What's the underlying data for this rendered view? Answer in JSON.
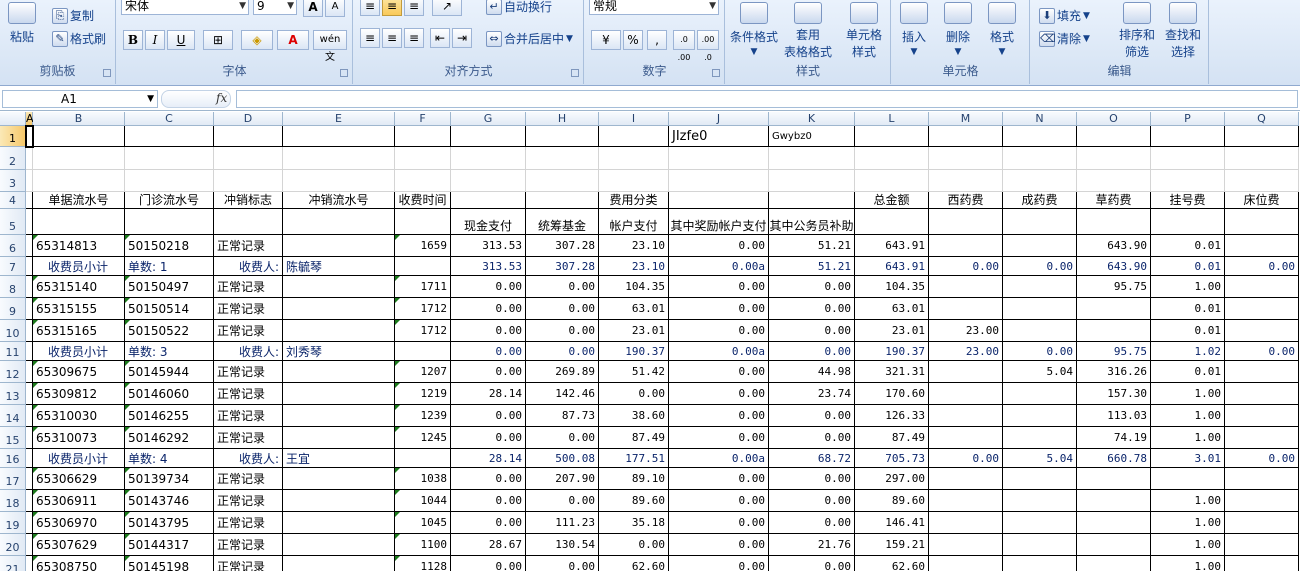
{
  "ribbon": {
    "clipboard": {
      "paste": "粘贴",
      "copy": "复制",
      "format_painter": "格式刷",
      "label": "剪贴板"
    },
    "font": {
      "name": "宋体",
      "size": "9",
      "label": "字体",
      "bold": "B",
      "italic": "I",
      "underline": "U",
      "grow": "A",
      "shrink": "A",
      "phonetic": "wén 文",
      "font_color": "A"
    },
    "alignment": {
      "wrap": "自动换行",
      "merge": "合并后居中",
      "label": "对齐方式"
    },
    "number": {
      "format": "常规",
      "percent": "%",
      "comma": ",",
      "inc_dec": ".0 .00",
      "dec_dec": ".00 .0",
      "label": "数字"
    },
    "styles": {
      "conditional": "条件格式",
      "table_fmt_1": "套用",
      "table_fmt_2": "表格格式",
      "cell_style_1": "单元格",
      "cell_style_2": "样式",
      "label": "样式"
    },
    "cells": {
      "insert": "插入",
      "delete": "删除",
      "format": "格式",
      "label": "单元格"
    },
    "editing": {
      "fill": "填充",
      "clear": "清除",
      "sort_1": "排序和",
      "sort_2": "筛选",
      "find_1": "查找和",
      "find_2": "选择",
      "label": "编辑"
    }
  },
  "formula_bar": {
    "name_box": "A1",
    "fx": "fx",
    "content": ""
  },
  "columns": [
    "A",
    "B",
    "C",
    "D",
    "E",
    "F",
    "G",
    "H",
    "I",
    "J",
    "K",
    "L",
    "M",
    "N",
    "O",
    "P",
    "Q"
  ],
  "rows": [
    {
      "n": "1",
      "cells": {
        "J": "JIzfe0",
        "K": "Gwybz0"
      }
    },
    {
      "n": "2",
      "cells": {}
    },
    {
      "n": "3",
      "cells": {}
    },
    {
      "n": "4",
      "cells": {
        "B": "单据流水号",
        "C": "门诊流水号",
        "D": "冲销标志",
        "E": "冲销流水号",
        "F": "收费时间",
        "I": "费用分类",
        "L": "总金额",
        "M": "西药费",
        "N": "成药费",
        "O": "草药费",
        "P": "挂号费",
        "Q": "床位费"
      }
    },
    {
      "n": "5",
      "cells": {
        "G": "现金支付",
        "H": "统筹基金",
        "I": "帐户支付",
        "J": "其中奖励帐户支付",
        "K": "其中公务员补助"
      }
    },
    {
      "n": "6",
      "cells": {
        "B": "65314813",
        "C": "50150218",
        "D": "正常记录",
        "F": "1659",
        "G": "313.53",
        "H": "307.28",
        "I": "23.10",
        "J": "0.00",
        "K": "51.21",
        "L": "643.91",
        "O": "643.90",
        "P": "0.01"
      }
    },
    {
      "n": "7",
      "sub": true,
      "cells": {
        "B": "收费员小计",
        "C": "单数: 1",
        "D": "收费人:",
        "E": "陈毓琴",
        "G": "313.53",
        "H": "307.28",
        "I": "23.10",
        "J": "0.00a",
        "K": "51.21",
        "L": "643.91",
        "M": "0.00",
        "N": "0.00",
        "O": "643.90",
        "P": "0.01",
        "Q": "0.00"
      }
    },
    {
      "n": "8",
      "cells": {
        "B": "65315140",
        "C": "50150497",
        "D": "正常记录",
        "F": "1711",
        "G": "0.00",
        "H": "0.00",
        "I": "104.35",
        "J": "0.00",
        "K": "0.00",
        "L": "104.35",
        "O": "95.75",
        "P": "1.00"
      }
    },
    {
      "n": "9",
      "cells": {
        "B": "65315155",
        "C": "50150514",
        "D": "正常记录",
        "F": "1712",
        "G": "0.00",
        "H": "0.00",
        "I": "63.01",
        "J": "0.00",
        "K": "0.00",
        "L": "63.01",
        "P": "0.01"
      }
    },
    {
      "n": "10",
      "cells": {
        "B": "65315165",
        "C": "50150522",
        "D": "正常记录",
        "F": "1712",
        "G": "0.00",
        "H": "0.00",
        "I": "23.01",
        "J": "0.00",
        "K": "0.00",
        "L": "23.01",
        "M": "23.00",
        "P": "0.01"
      }
    },
    {
      "n": "11",
      "sub": true,
      "cells": {
        "B": "收费员小计",
        "C": "单数: 3",
        "D": "收费人:",
        "E": "刘秀琴",
        "G": "0.00",
        "H": "0.00",
        "I": "190.37",
        "J": "0.00a",
        "K": "0.00",
        "L": "190.37",
        "M": "23.00",
        "N": "0.00",
        "O": "95.75",
        "P": "1.02",
        "Q": "0.00"
      }
    },
    {
      "n": "12",
      "cells": {
        "B": "65309675",
        "C": "50145944",
        "D": "正常记录",
        "F": "1207",
        "G": "0.00",
        "H": "269.89",
        "I": "51.42",
        "J": "0.00",
        "K": "44.98",
        "L": "321.31",
        "N": "5.04",
        "O": "316.26",
        "P": "0.01"
      }
    },
    {
      "n": "13",
      "cells": {
        "B": "65309812",
        "C": "50146060",
        "D": "正常记录",
        "F": "1219",
        "G": "28.14",
        "H": "142.46",
        "I": "0.00",
        "J": "0.00",
        "K": "23.74",
        "L": "170.60",
        "O": "157.30",
        "P": "1.00"
      }
    },
    {
      "n": "14",
      "cells": {
        "B": "65310030",
        "C": "50146255",
        "D": "正常记录",
        "F": "1239",
        "G": "0.00",
        "H": "87.73",
        "I": "38.60",
        "J": "0.00",
        "K": "0.00",
        "L": "126.33",
        "O": "113.03",
        "P": "1.00"
      }
    },
    {
      "n": "15",
      "cells": {
        "B": "65310073",
        "C": "50146292",
        "D": "正常记录",
        "F": "1245",
        "G": "0.00",
        "H": "0.00",
        "I": "87.49",
        "J": "0.00",
        "K": "0.00",
        "L": "87.49",
        "O": "74.19",
        "P": "1.00"
      }
    },
    {
      "n": "16",
      "sub": true,
      "cells": {
        "B": "收费员小计",
        "C": "单数: 4",
        "D": "收费人:",
        "E": "王宜",
        "G": "28.14",
        "H": "500.08",
        "I": "177.51",
        "J": "0.00a",
        "K": "68.72",
        "L": "705.73",
        "M": "0.00",
        "N": "5.04",
        "O": "660.78",
        "P": "3.01",
        "Q": "0.00"
      }
    },
    {
      "n": "17",
      "cells": {
        "B": "65306629",
        "C": "50139734",
        "D": "正常记录",
        "F": "1038",
        "G": "0.00",
        "H": "207.90",
        "I": "89.10",
        "J": "0.00",
        "K": "0.00",
        "L": "297.00"
      }
    },
    {
      "n": "18",
      "cells": {
        "B": "65306911",
        "C": "50143746",
        "D": "正常记录",
        "F": "1044",
        "G": "0.00",
        "H": "0.00",
        "I": "89.60",
        "J": "0.00",
        "K": "0.00",
        "L": "89.60",
        "P": "1.00"
      }
    },
    {
      "n": "19",
      "cells": {
        "B": "65306970",
        "C": "50143795",
        "D": "正常记录",
        "F": "1045",
        "G": "0.00",
        "H": "111.23",
        "I": "35.18",
        "J": "0.00",
        "K": "0.00",
        "L": "146.41",
        "P": "1.00"
      }
    },
    {
      "n": "20",
      "cells": {
        "B": "65307629",
        "C": "50144317",
        "D": "正常记录",
        "F": "1100",
        "G": "28.67",
        "H": "130.54",
        "I": "0.00",
        "J": "0.00",
        "K": "21.76",
        "L": "159.21",
        "P": "1.00"
      }
    },
    {
      "n": "21",
      "cells": {
        "B": "65308750",
        "C": "50145198",
        "D": "正常记录",
        "F": "1128",
        "G": "0.00",
        "H": "0.00",
        "I": "62.60",
        "J": "0.00",
        "K": "0.00",
        "L": "62.60",
        "P": "1.00"
      }
    }
  ]
}
